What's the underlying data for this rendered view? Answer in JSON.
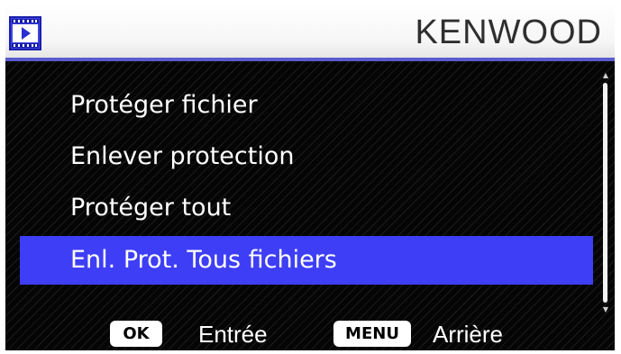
{
  "header": {
    "mode_icon": "playback-icon",
    "brand": "KENWOOD"
  },
  "menu": {
    "items": [
      {
        "label": "Protéger fichier",
        "selected": false
      },
      {
        "label": "Enlever protection",
        "selected": false
      },
      {
        "label": "Protéger tout",
        "selected": false
      },
      {
        "label": "Enl. Prot. Tous fichiers",
        "selected": true
      }
    ]
  },
  "footer": {
    "ok_key": "OK",
    "ok_action": "Entrée",
    "menu_key": "MENU",
    "menu_action": "Arrière"
  },
  "colors": {
    "selection": "#3e3ef6",
    "header_accent": "#5a5ccc",
    "icon_bg": "#3d43e6"
  }
}
